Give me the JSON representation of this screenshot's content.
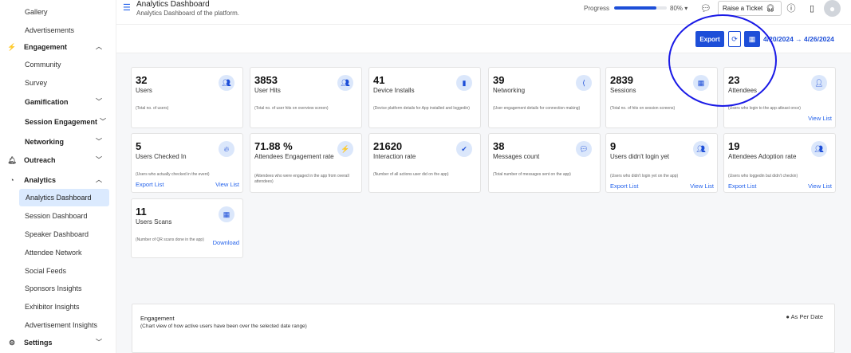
{
  "sidebar": {
    "items": [
      {
        "label": "Gallery"
      },
      {
        "label": "Advertisements"
      },
      {
        "label": "Engagement"
      },
      {
        "label": "Community"
      },
      {
        "label": "Survey"
      },
      {
        "label": "Gamification"
      },
      {
        "label": "Session Engagement"
      },
      {
        "label": "Networking"
      },
      {
        "label": "Outreach"
      },
      {
        "label": "Analytics"
      },
      {
        "label": "Analytics Dashboard"
      },
      {
        "label": "Session Dashboard"
      },
      {
        "label": "Speaker Dashboard"
      },
      {
        "label": "Attendee Network"
      },
      {
        "label": "Social Feeds"
      },
      {
        "label": "Sponsors Insights"
      },
      {
        "label": "Exhibitor Insights"
      },
      {
        "label": "Advertisement Insights"
      },
      {
        "label": "Settings"
      }
    ]
  },
  "header": {
    "title": "Analytics Dashboard",
    "subtitle": "Analytics Dashboard of the platform.",
    "progress_label": "Progress",
    "progress_value": "80%",
    "progress_fraction": 0.8,
    "raise_ticket": "Raise a Ticket"
  },
  "controls": {
    "export_label": "Export",
    "date_range": "4/20/2024 → 4/26/2024"
  },
  "cards": [
    {
      "value": "32",
      "label": "Users",
      "desc": "(Total no. of users)",
      "icon": "users-icon"
    },
    {
      "value": "3853",
      "label": "User Hits",
      "desc": "(Total no. of user hits on overview screen)",
      "icon": "users-icon"
    },
    {
      "value": "41",
      "label": "Device Installs",
      "desc": "(Device platform details for App installed and loggedin)",
      "icon": "device-icon"
    },
    {
      "value": "39",
      "label": "Networking",
      "desc": "(User engagement details for connection making)",
      "icon": "share-icon"
    },
    {
      "value": "2839",
      "label": "Sessions",
      "desc": "(Total no. of hits on session screens)",
      "icon": "calendar-icon"
    },
    {
      "value": "23",
      "label": "Attendees",
      "desc": "(Users who login to the app atleast once)",
      "icon": "user-icon",
      "link_right": "View List"
    },
    {
      "value": "5",
      "label": "Users Checked In",
      "desc": "(Users who actually checked in the event)",
      "icon": "fire-icon",
      "link_left": "Export List",
      "link_right": "View List"
    },
    {
      "value": "71.88 %",
      "label": "Attendees Engagement rate",
      "desc": "(Attendees who were engaged in the app from overall attendees)",
      "icon": "bolt-icon"
    },
    {
      "value": "21620",
      "label": "Interaction rate",
      "desc": "(Number of all actions user did on the app)",
      "icon": "check-icon"
    },
    {
      "value": "38",
      "label": "Messages count",
      "desc": "(Total number of messages sent on the app)",
      "icon": "chat-icon"
    },
    {
      "value": "9",
      "label": "Users didn't login yet",
      "desc": "(Users who didn't login yet on the app)",
      "icon": "users-icon",
      "link_left": "Export List",
      "link_right": "View List"
    },
    {
      "value": "19",
      "label": "Attendees Adoption rate",
      "desc": "(Users who loggedin but didn't checkin)",
      "icon": "users-icon",
      "link_left": "Export List",
      "link_right": "View List"
    },
    {
      "value": "11",
      "label": "Users Scans",
      "desc": "(Number of QR scans done in the app)",
      "icon": "qr-icon",
      "link_right": "Download"
    }
  ],
  "engagement": {
    "title": "Engagement",
    "subtitle": "(Chart view of how active users have been over the selected date range)",
    "legend": "As Per Date"
  }
}
